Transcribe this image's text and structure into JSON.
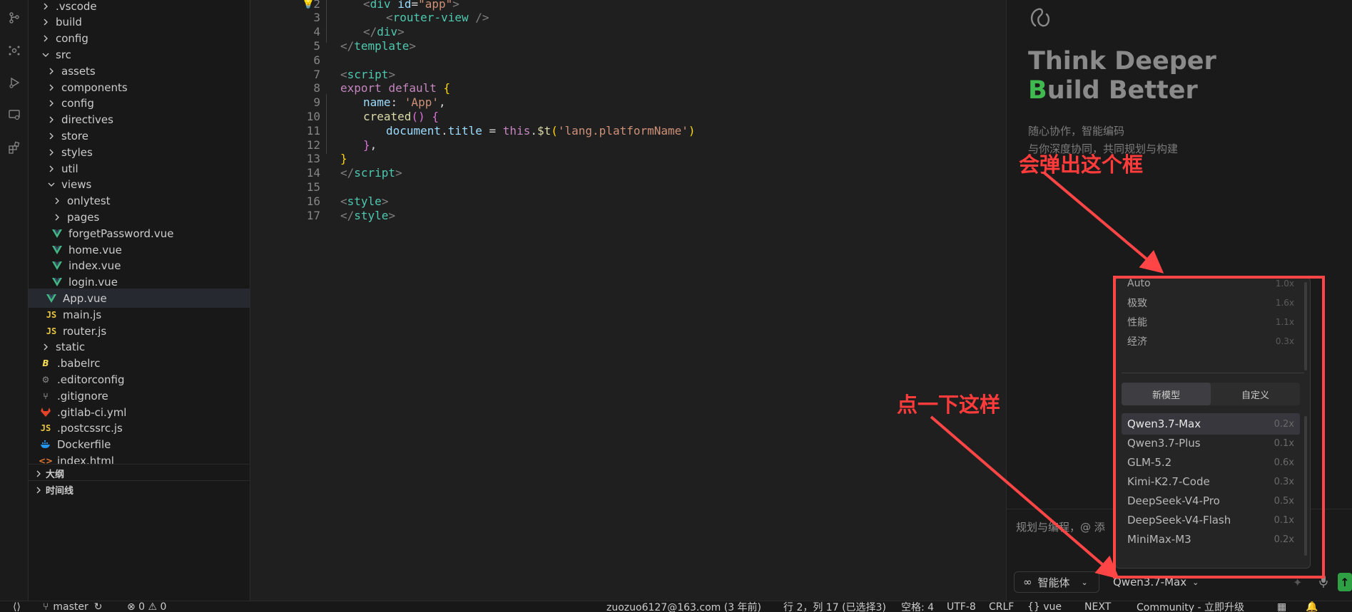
{
  "explorer": {
    "items": [
      {
        "label": ".vscode",
        "kind": "folder",
        "open": false,
        "depth": 0
      },
      {
        "label": "build",
        "kind": "folder",
        "open": false,
        "depth": 0
      },
      {
        "label": "config",
        "kind": "folder",
        "open": false,
        "depth": 0
      },
      {
        "label": "src",
        "kind": "folder",
        "open": true,
        "depth": 0
      },
      {
        "label": "assets",
        "kind": "folder",
        "open": false,
        "depth": 1
      },
      {
        "label": "components",
        "kind": "folder",
        "open": false,
        "depth": 1
      },
      {
        "label": "config",
        "kind": "folder",
        "open": false,
        "depth": 1
      },
      {
        "label": "directives",
        "kind": "folder",
        "open": false,
        "depth": 1
      },
      {
        "label": "store",
        "kind": "folder",
        "open": false,
        "depth": 1
      },
      {
        "label": "styles",
        "kind": "folder",
        "open": false,
        "depth": 1
      },
      {
        "label": "util",
        "kind": "folder",
        "open": false,
        "depth": 1
      },
      {
        "label": "views",
        "kind": "folder",
        "open": true,
        "depth": 1
      },
      {
        "label": "onlytest",
        "kind": "folder",
        "open": false,
        "depth": 2
      },
      {
        "label": "pages",
        "kind": "folder",
        "open": false,
        "depth": 2
      },
      {
        "label": "forgetPassword.vue",
        "kind": "vue",
        "depth": 2
      },
      {
        "label": "home.vue",
        "kind": "vue",
        "depth": 2
      },
      {
        "label": "index.vue",
        "kind": "vue",
        "depth": 2
      },
      {
        "label": "login.vue",
        "kind": "vue",
        "depth": 2
      },
      {
        "label": "App.vue",
        "kind": "vue",
        "depth": 1,
        "selected": true
      },
      {
        "label": "main.js",
        "kind": "js",
        "depth": 1
      },
      {
        "label": "router.js",
        "kind": "js",
        "depth": 1
      },
      {
        "label": "static",
        "kind": "folder",
        "open": false,
        "depth": 0
      },
      {
        "label": ".babelrc",
        "kind": "babel",
        "depth": 0
      },
      {
        "label": ".editorconfig",
        "kind": "gear",
        "depth": 0
      },
      {
        "label": ".gitignore",
        "kind": "git",
        "depth": 0
      },
      {
        "label": ".gitlab-ci.yml",
        "kind": "gitlab",
        "depth": 0
      },
      {
        "label": ".postcssrc.js",
        "kind": "js",
        "depth": 0
      },
      {
        "label": "Dockerfile",
        "kind": "docker",
        "depth": 0
      },
      {
        "label": "index.html",
        "kind": "html",
        "depth": 0
      }
    ],
    "sections": [
      {
        "label": "大纲"
      },
      {
        "label": "时间线"
      }
    ]
  },
  "editor": {
    "lines": [
      {
        "n": "2",
        "indent": 1,
        "html": "<span class=\"tok-punct\">&lt;</span><span class=\"tok-tag\">div</span> <span class=\"tok-var\">id</span><span class=\"tok-plain\">=</span><span class=\"tok-str\">\"app\"</span><span class=\"tok-punct\">&gt;</span>"
      },
      {
        "n": "3",
        "indent": 2,
        "html": "<span class=\"tok-punct\">&lt;</span><span class=\"tok-tag\">router-view</span> <span class=\"tok-punct\">/&gt;</span>"
      },
      {
        "n": "4",
        "indent": 1,
        "html": "<span class=\"tok-punct\">&lt;/</span><span class=\"tok-tag\">div</span><span class=\"tok-punct\">&gt;</span>"
      },
      {
        "n": "5",
        "indent": 0,
        "html": "<span class=\"tok-punct\">&lt;/</span><span class=\"tok-tag\">template</span><span class=\"tok-punct\">&gt;</span>"
      },
      {
        "n": "6",
        "indent": 0,
        "html": ""
      },
      {
        "n": "7",
        "indent": 0,
        "html": "<span class=\"tok-punct\">&lt;</span><span class=\"tok-tag\">script</span><span class=\"tok-punct\">&gt;</span>"
      },
      {
        "n": "8",
        "indent": 0,
        "html": "<span class=\"tok-kw\">export</span> <span class=\"tok-kw\">default</span> <span class=\"tok-brace\">{</span>"
      },
      {
        "n": "9",
        "indent": 1,
        "html": "<span class=\"tok-var\">name</span><span class=\"tok-plain\">: </span><span class=\"tok-str\">'App'</span><span class=\"tok-plain\">,</span>"
      },
      {
        "n": "10",
        "indent": 1,
        "html": "<span class=\"tok-fn\">created</span><span class=\"tok-brace2\">()</span> <span class=\"tok-brace2\">{</span>"
      },
      {
        "n": "11",
        "indent": 2,
        "html": "<span class=\"tok-var\">document</span><span class=\"tok-plain\">.</span><span class=\"tok-var\">title</span> <span class=\"tok-plain\">=</span> <span class=\"tok-kw\">this</span><span class=\"tok-plain\">.</span><span class=\"tok-fn\">$t</span><span class=\"tok-brace\">(</span><span class=\"tok-str\">'lang.platformName'</span><span class=\"tok-brace\">)</span>"
      },
      {
        "n": "12",
        "indent": 1,
        "html": "<span class=\"tok-brace2\">}</span><span class=\"tok-plain\">,</span>"
      },
      {
        "n": "13",
        "indent": 0,
        "html": "<span class=\"tok-brace\">}</span>"
      },
      {
        "n": "14",
        "indent": 0,
        "html": "<span class=\"tok-punct\">&lt;/</span><span class=\"tok-tag\">script</span><span class=\"tok-punct\">&gt;</span>"
      },
      {
        "n": "15",
        "indent": 0,
        "html": ""
      },
      {
        "n": "16",
        "indent": 0,
        "html": "<span class=\"tok-punct\">&lt;</span><span class=\"tok-tag\">style</span><span class=\"tok-punct\">&gt;</span>"
      },
      {
        "n": "17",
        "indent": 0,
        "html": "<span class=\"tok-punct\">&lt;/</span><span class=\"tok-tag\">style</span><span class=\"tok-punct\">&gt;</span>"
      }
    ]
  },
  "panel": {
    "heading_line1": "Think Deeper",
    "heading_line2_accent": "B",
    "heading_line2_rest": "uild Better",
    "sub_line1": "随心协作，智能编码",
    "sub_line2": "与你深度协同，共同规划与构建",
    "input_placeholder": "规划与编程，@ 添",
    "mode_label": "智能体",
    "model_label": "Qwen3.7-Max"
  },
  "dropdown": {
    "presets": [
      {
        "label": "Auto",
        "mult": "1.0x"
      },
      {
        "label": "极致",
        "mult": "1.6x"
      },
      {
        "label": "性能",
        "mult": "1.1x"
      },
      {
        "label": "经济",
        "mult": "0.3x"
      }
    ],
    "tabs": [
      {
        "label": "新模型",
        "active": true
      },
      {
        "label": "自定义",
        "active": false
      }
    ],
    "models": [
      {
        "label": "Qwen3.7-Max",
        "mult": "0.2x",
        "active": true
      },
      {
        "label": "Qwen3.7-Plus",
        "mult": "0.1x"
      },
      {
        "label": "GLM-5.2",
        "mult": "0.6x"
      },
      {
        "label": "Kimi-K2.7-Code",
        "mult": "0.3x"
      },
      {
        "label": "DeepSeek-V4-Pro",
        "mult": "0.5x"
      },
      {
        "label": "DeepSeek-V4-Flash",
        "mult": "0.1x"
      },
      {
        "label": "MiniMax-M3",
        "mult": "0.2x"
      }
    ]
  },
  "annotations": {
    "top_text": "会弹出这个框",
    "bottom_text": "点一下这样",
    "color": "#ff4545"
  },
  "statusbar": {
    "branch": "master",
    "problems": "⊗ 0 ⚠ 0",
    "author": "zuozuo6127@163.com (3 年前)",
    "position": "行 2，列 17 (已选择3)",
    "spaces": "空格: 4",
    "encoding": "UTF-8",
    "eol": "CRLF",
    "language": "{} vue",
    "next": "NEXT",
    "community": "Community - 立即升级"
  }
}
